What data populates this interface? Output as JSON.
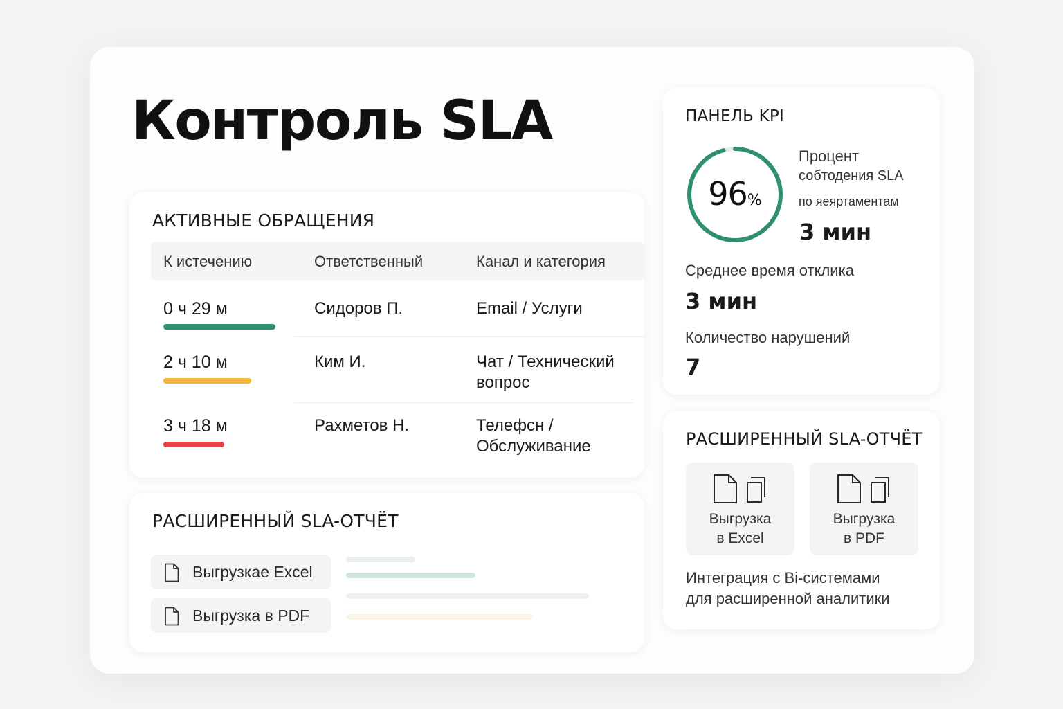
{
  "title": "Контроль SLA",
  "colors": {
    "green": "#2f8f73",
    "yellow": "#f2b63a",
    "red": "#e94545",
    "donut_track": "#ececec"
  },
  "active_tickets": {
    "heading": "АКТИВНЫЕ ОБРАЩЕНИЯ",
    "columns": [
      "К истечению",
      "Ответственный",
      "Канал и категория"
    ],
    "rows": [
      {
        "deadline": "0 ч 29 м",
        "assignee": "Сидоров П.",
        "channel_line1": "Email / Услуги",
        "channel_line2": "",
        "status": "green",
        "bar_fill": 0.9
      },
      {
        "deadline": "2 ч 10 м",
        "assignee": "Ким И.",
        "channel_line1": "Чат / Технический",
        "channel_line2": "вопрос",
        "status": "yellow",
        "bar_fill": 0.7
      },
      {
        "deadline": "3 ч 18 м",
        "assignee": "Рахметов Н.",
        "channel_line1": "Телефсн /",
        "channel_line2": "Обслуживание",
        "status": "red",
        "bar_fill": 0.48
      }
    ]
  },
  "report_left": {
    "heading": "РАСШИРЕННЫЙ SLA-ОТЧЁТ",
    "excel_label": "Выгрузкае Excel",
    "pdf_label": "Выгрузка в PDF",
    "icon": "document-icon"
  },
  "kpi": {
    "heading": "ПАНЕЛЬ KPI",
    "compliance_value": "96",
    "compliance_unit": "%",
    "compliance_fraction": 0.96,
    "compliance_label_1": "Процент",
    "compliance_label_2": "собтодения SLA",
    "compliance_label_3": "по яеяртаментам",
    "compliance_time": "3 мин",
    "avg_response_label": "Среднее время отклика",
    "avg_response_value": "3 мин",
    "violations_label": "Количество нарушений",
    "violations_value": "7"
  },
  "report_right": {
    "heading": "РАСШИРЕННЫЙ SLA-ОТЧЁТ",
    "excel_line1": "Выгрузка",
    "excel_line2": "в Excel",
    "pdf_line1": "Выгрузка",
    "pdf_line2": "в PDF",
    "integration_line1": "Интеграция с Bi-системами",
    "integration_line2": "для расширенной аналитики",
    "icons": [
      "document-icon",
      "copy-icon"
    ]
  }
}
